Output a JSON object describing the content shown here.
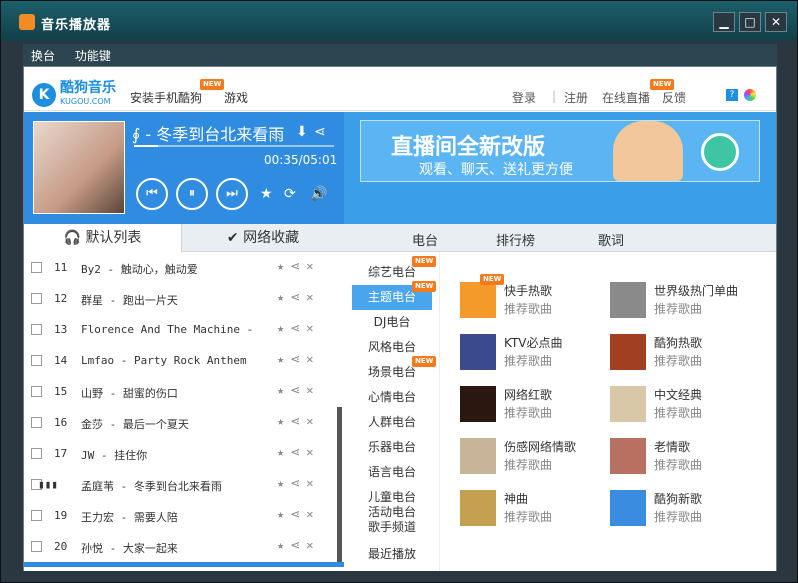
{
  "window": {
    "title": "音乐播放器"
  },
  "menu": {
    "items": [
      "换台",
      "功能键"
    ]
  },
  "header": {
    "logo_text": "酷狗音乐",
    "logo_sub": "KUGOU.COM",
    "install_label": "安装手机酷狗",
    "games_label": "游戏",
    "new_badge": "NEW",
    "login": "登录",
    "register": "注册",
    "live": "在线直播",
    "feedback": "反馈"
  },
  "player": {
    "song": "∮ - 冬季到台北来看雨",
    "time": "00:35/05:01",
    "progress": 0.12
  },
  "banner": {
    "line1": "直播间全新改版",
    "line2": "观看、聊天、送礼更方便"
  },
  "left_tabs": [
    "默认列表",
    "网络收藏"
  ],
  "right_tabs": [
    "电台",
    "排行榜",
    "歌词"
  ],
  "playlist": [
    {
      "num": "11",
      "title": "By2 - 触动心，触动爱"
    },
    {
      "num": "12",
      "title": "群星 - 跑出一片天"
    },
    {
      "num": "13",
      "title": "Florence And The Machine -"
    },
    {
      "num": "14",
      "title": "Lmfao - Party Rock Anthem"
    },
    {
      "num": "15",
      "title": "山野 - 甜蜜的伤口"
    },
    {
      "num": "16",
      "title": "金莎 - 最后一个夏天"
    },
    {
      "num": "17",
      "title": "JW - 挂住你"
    },
    {
      "num": "",
      "title": "孟庭苇 - 冬季到台北来看雨"
    },
    {
      "num": "19",
      "title": "王力宏 - 需要人陪"
    },
    {
      "num": "20",
      "title": "孙悦 - 大家一起来"
    }
  ],
  "radio_nav": [
    "综艺电台",
    "主题电台",
    "DJ电台",
    "风格电台",
    "场景电台",
    "心情电台",
    "人群电台",
    "乐器电台",
    "语言电台",
    "儿童电台",
    "活动电台",
    "歌手频道",
    "最近播放"
  ],
  "cards": [
    {
      "name": "快手热歌",
      "sub": "推荐歌曲"
    },
    {
      "name": "世界级热门单曲",
      "sub": "推荐歌曲"
    },
    {
      "name": "KTV必点曲",
      "sub": "推荐歌曲"
    },
    {
      "name": "酷狗热歌",
      "sub": "推荐歌曲"
    },
    {
      "name": "网络红歌",
      "sub": "推荐歌曲"
    },
    {
      "name": "中文经典",
      "sub": "推荐歌曲"
    },
    {
      "name": "伤感网络情歌",
      "sub": "推荐歌曲"
    },
    {
      "name": "老情歌",
      "sub": "推荐歌曲"
    },
    {
      "name": "神曲",
      "sub": "推荐歌曲"
    },
    {
      "name": "酷狗新歌",
      "sub": "推荐歌曲"
    }
  ],
  "colors": {
    "accent": "#2f8ce0",
    "badge": "#f47a1c"
  }
}
